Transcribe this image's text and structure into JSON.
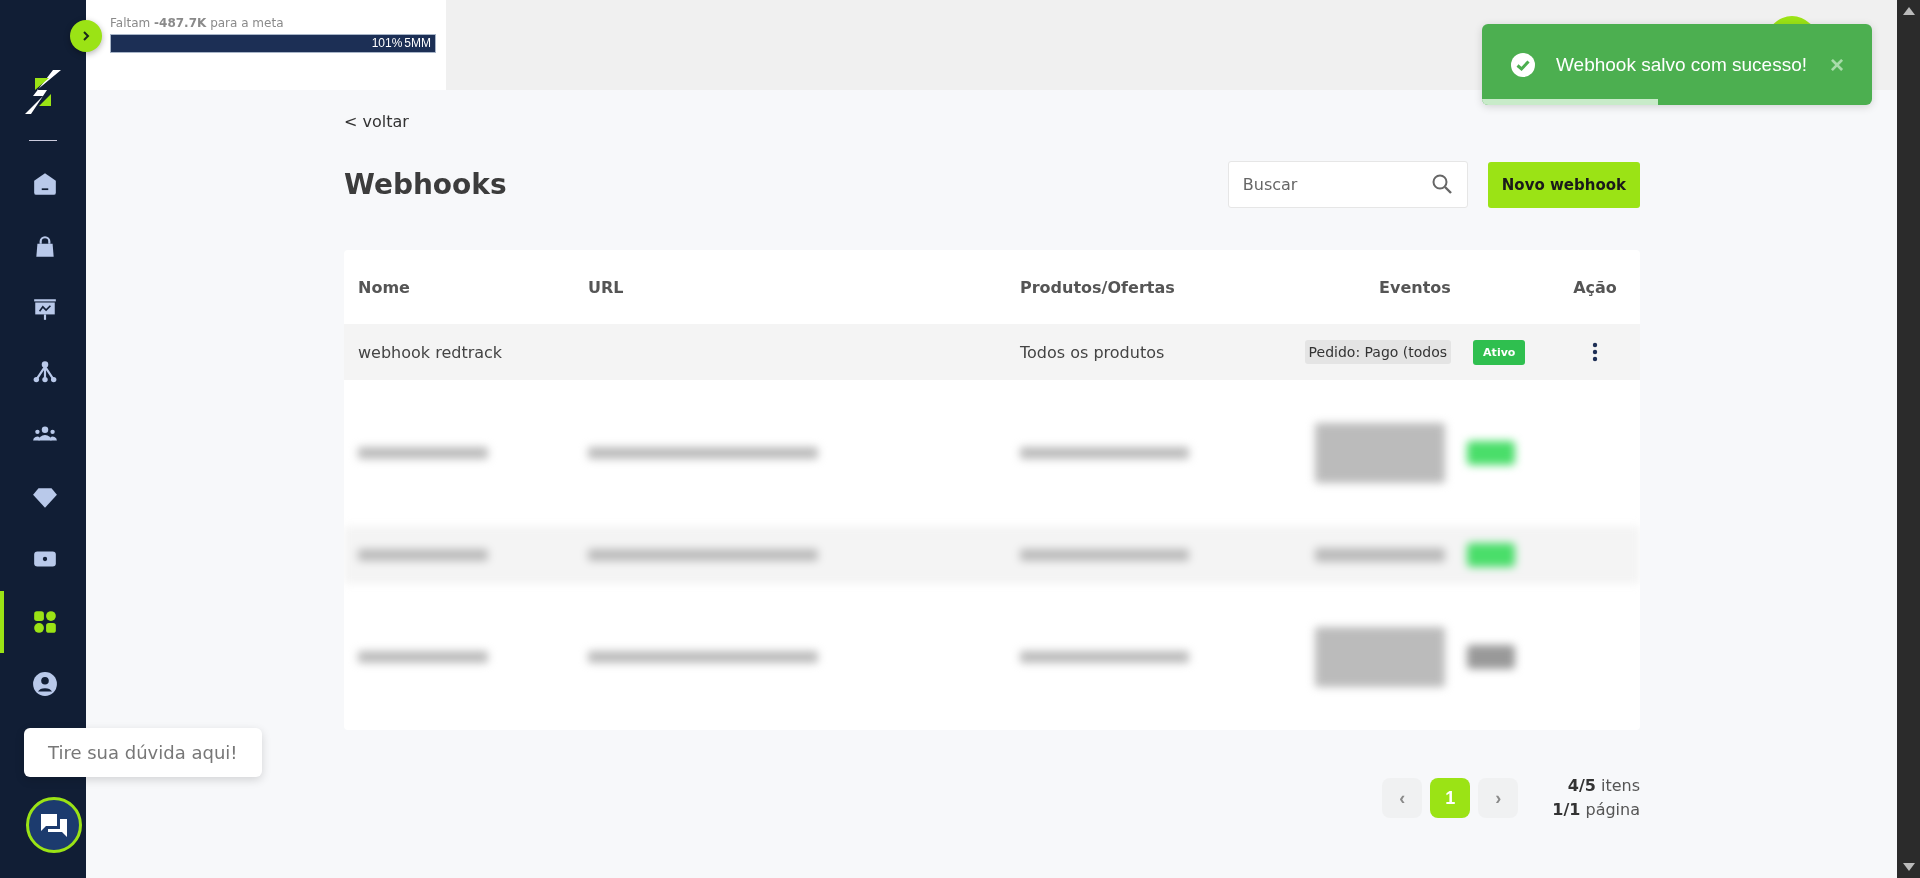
{
  "sidebar": {
    "items": [
      {
        "kind": "home",
        "selected": false
      },
      {
        "kind": "bag",
        "selected": false
      },
      {
        "kind": "chart",
        "selected": false
      },
      {
        "kind": "network",
        "selected": false
      },
      {
        "kind": "people",
        "selected": false
      },
      {
        "kind": "diamond",
        "selected": false
      },
      {
        "kind": "money",
        "selected": false
      },
      {
        "kind": "apps",
        "selected": true
      },
      {
        "kind": "user",
        "selected": false
      }
    ]
  },
  "goal": {
    "text": "Faltam **-487.7K** para a meta",
    "level": 1,
    "percent": "101%",
    "target": "5MM"
  },
  "toast": {
    "message": "Webhook salvo com sucesso!",
    "close": "×",
    "level": 0.45
  },
  "back_link": "< voltar",
  "page_title": "Webhooks",
  "search": {
    "placeholder": "Buscar"
  },
  "new_button": "Novo webhook",
  "table": {
    "columns": [
      "Nome",
      "URL",
      "Produtos/Ofertas",
      "Eventos",
      "Ação"
    ],
    "rows": [
      {
        "kind": "normal",
        "name": "webhook redtrack",
        "products": "Todos os produtos",
        "event": "Pedido: Pago (todos",
        "status": "Ativo",
        "active": true
      },
      {
        "kind": "blurred",
        "active": true
      },
      {
        "kind": "blurred",
        "active": true
      },
      {
        "kind": "blurred",
        "active": false
      }
    ]
  },
  "pagination": {
    "prev": "‹",
    "page": "1",
    "next": "›",
    "items_count": "4/5",
    "items_label": "itens",
    "pages_count": "1/1",
    "pages_label": "página"
  },
  "chat": {
    "tooltip": "Tire sua dúvida aqui!"
  }
}
